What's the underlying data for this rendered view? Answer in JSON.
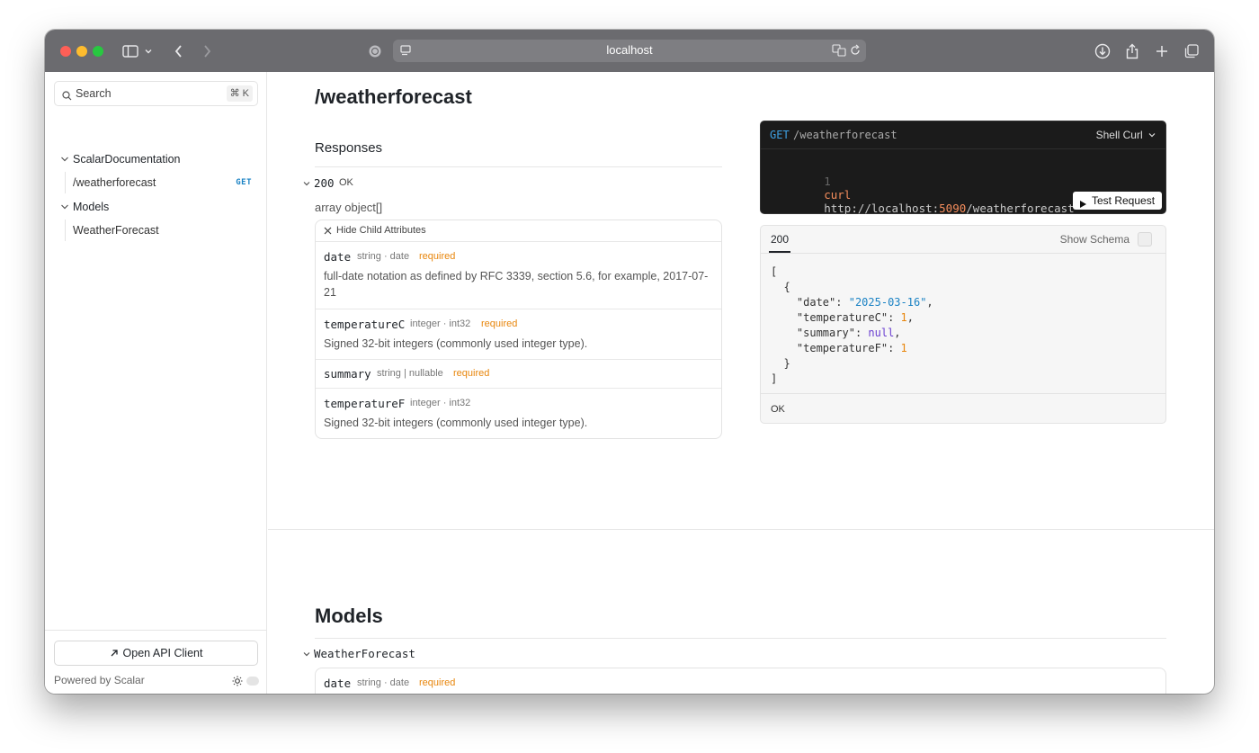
{
  "browser": {
    "url": "localhost",
    "colors": {
      "close": "#fe5f57",
      "minimize": "#febc2e",
      "zoom": "#28c840"
    }
  },
  "sidebar": {
    "search_placeholder": "Search",
    "search_shortcut": "⌘ K",
    "items": [
      {
        "label": "ScalarDocumentation"
      },
      {
        "label": "/weatherforecast",
        "badge": "GET"
      },
      {
        "label": "Models"
      },
      {
        "label": "WeatherForecast"
      }
    ],
    "open_client_label": "Open API Client",
    "powered_by": "Powered by Scalar"
  },
  "endpoint": {
    "path": "/weatherforecast",
    "responses_label": "Responses",
    "status_code": "200",
    "status_text": "OK",
    "array_type": "array object[]",
    "hide_child_label": "Hide Child Attributes",
    "properties": [
      {
        "name": "date",
        "type": "string · date",
        "required": "required",
        "desc": "full-date notation as defined by RFC 3339, section 5.6, for example, 2017-07-21"
      },
      {
        "name": "temperatureC",
        "type": "integer · int32",
        "required": "required",
        "desc": "Signed 32-bit integers (commonly used integer type)."
      },
      {
        "name": "summary",
        "type": "string | nullable",
        "required": "required",
        "desc": ""
      },
      {
        "name": "temperatureF",
        "type": "integer · int32",
        "required": "",
        "desc": "Signed 32-bit integers (commonly used integer type)."
      }
    ]
  },
  "request_card": {
    "method": "GET",
    "path": "/weatherforecast",
    "client": "Shell Curl",
    "line_number": "1",
    "cmd": "curl",
    "url_start": "http://localhost:",
    "port": "5090",
    "url_end": "/weatherforecast",
    "test_button": "Test Request"
  },
  "response_card": {
    "tab": "200",
    "show_schema": "Show Schema",
    "json": {
      "open_bracket": "[",
      "open_brace": "{",
      "date_key": "\"date\"",
      "date_val": "\"2025-03-16\"",
      "tempc_key": "\"temperatureC\"",
      "tempc_val": "1",
      "summary_key": "\"summary\"",
      "summary_val": "null",
      "tempf_key": "\"temperatureF\"",
      "tempf_val": "1",
      "close_brace": "}",
      "close_bracket": "]"
    },
    "footer": "OK"
  },
  "models": {
    "title": "Models",
    "model_name": "WeatherForecast",
    "first_prop": {
      "name": "date",
      "type": "string · date",
      "required": "required"
    }
  }
}
